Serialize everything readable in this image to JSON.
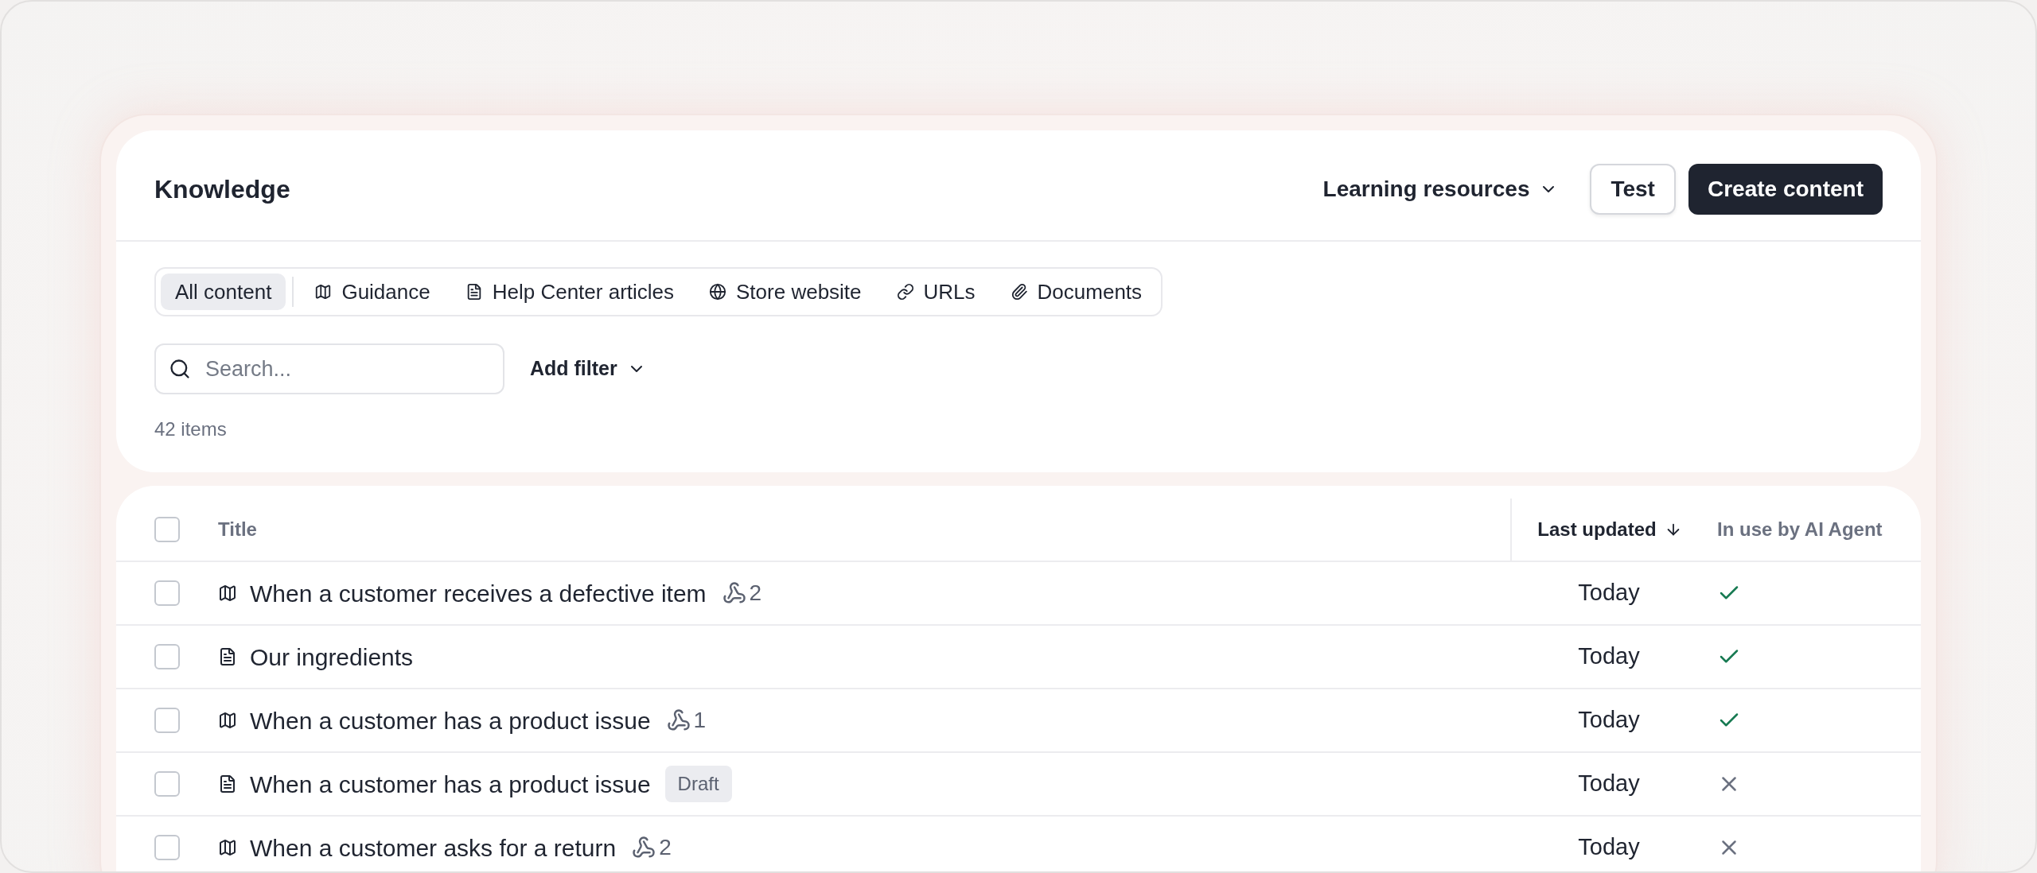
{
  "header": {
    "title": "Knowledge",
    "menu": "Learning resources",
    "buttons": [
      {
        "label": "Test",
        "kind": "secondary"
      },
      {
        "label": "Create content",
        "kind": "primary"
      }
    ]
  },
  "tabs": [
    {
      "label": "All content",
      "kind": "all",
      "selected": true
    },
    {
      "label": "Guidance",
      "kind": "guidance",
      "selected": false
    },
    {
      "label": "Help Center articles",
      "kind": "article",
      "selected": false
    },
    {
      "label": "Store website",
      "kind": "website",
      "selected": false
    },
    {
      "label": "URLs",
      "kind": "url",
      "selected": false
    },
    {
      "label": "Documents",
      "kind": "document",
      "selected": false
    }
  ],
  "search": {
    "placeholder": "Search..."
  },
  "filter": "Add filter",
  "count": "42 items",
  "table": {
    "select_all_checked": false,
    "columns": [
      {
        "label": "Title",
        "sorted": false
      },
      {
        "label": "Last updated",
        "sorted": true
      },
      {
        "label": "In use by AI Agent",
        "sorted": false
      }
    ],
    "rows": [
      {
        "title": "When a customer receives a defective item",
        "kind": "guidance",
        "checked": false,
        "links": "2",
        "updated": "Today",
        "in_use": true
      },
      {
        "title": "Our ingredients",
        "kind": "article",
        "checked": false,
        "updated": "Today",
        "in_use": true
      },
      {
        "title": "When a customer has a product issue",
        "kind": "guidance",
        "checked": false,
        "links": "1",
        "updated": "Today",
        "in_use": true
      },
      {
        "title": "When a customer has a product issue",
        "kind": "article",
        "checked": false,
        "badge": "Draft",
        "updated": "Today",
        "in_use": false
      },
      {
        "title": "When a customer asks for a return",
        "kind": "guidance",
        "checked": false,
        "links": "2",
        "updated": "Today",
        "in_use": false
      }
    ]
  }
}
